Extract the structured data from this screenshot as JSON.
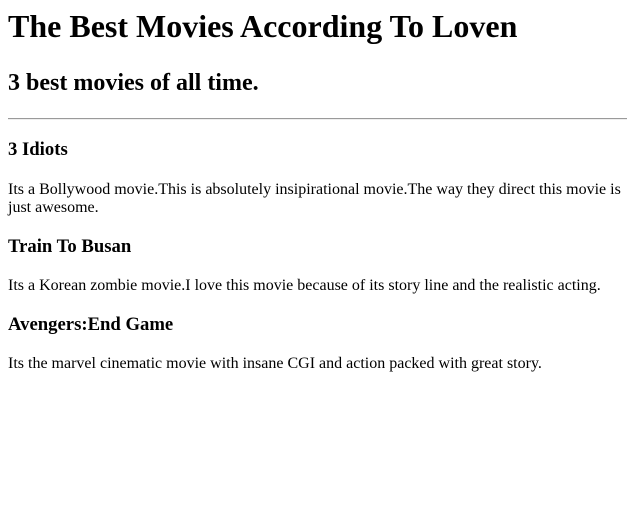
{
  "header": {
    "title": "The Best Movies According To Loven",
    "subtitle": "3 best movies of all time."
  },
  "movies": [
    {
      "title": "3 Idiots",
      "description": "Its a Bollywood movie.This is absolutely insipirational movie.The way they direct this movie is just awesome."
    },
    {
      "title": "Train To Busan",
      "description": "Its a Korean zombie movie.I love this movie because of its story line and the realistic acting."
    },
    {
      "title": "Avengers:End Game",
      "description": "Its the marvel cinematic movie with insane CGI and action packed with great story."
    }
  ]
}
